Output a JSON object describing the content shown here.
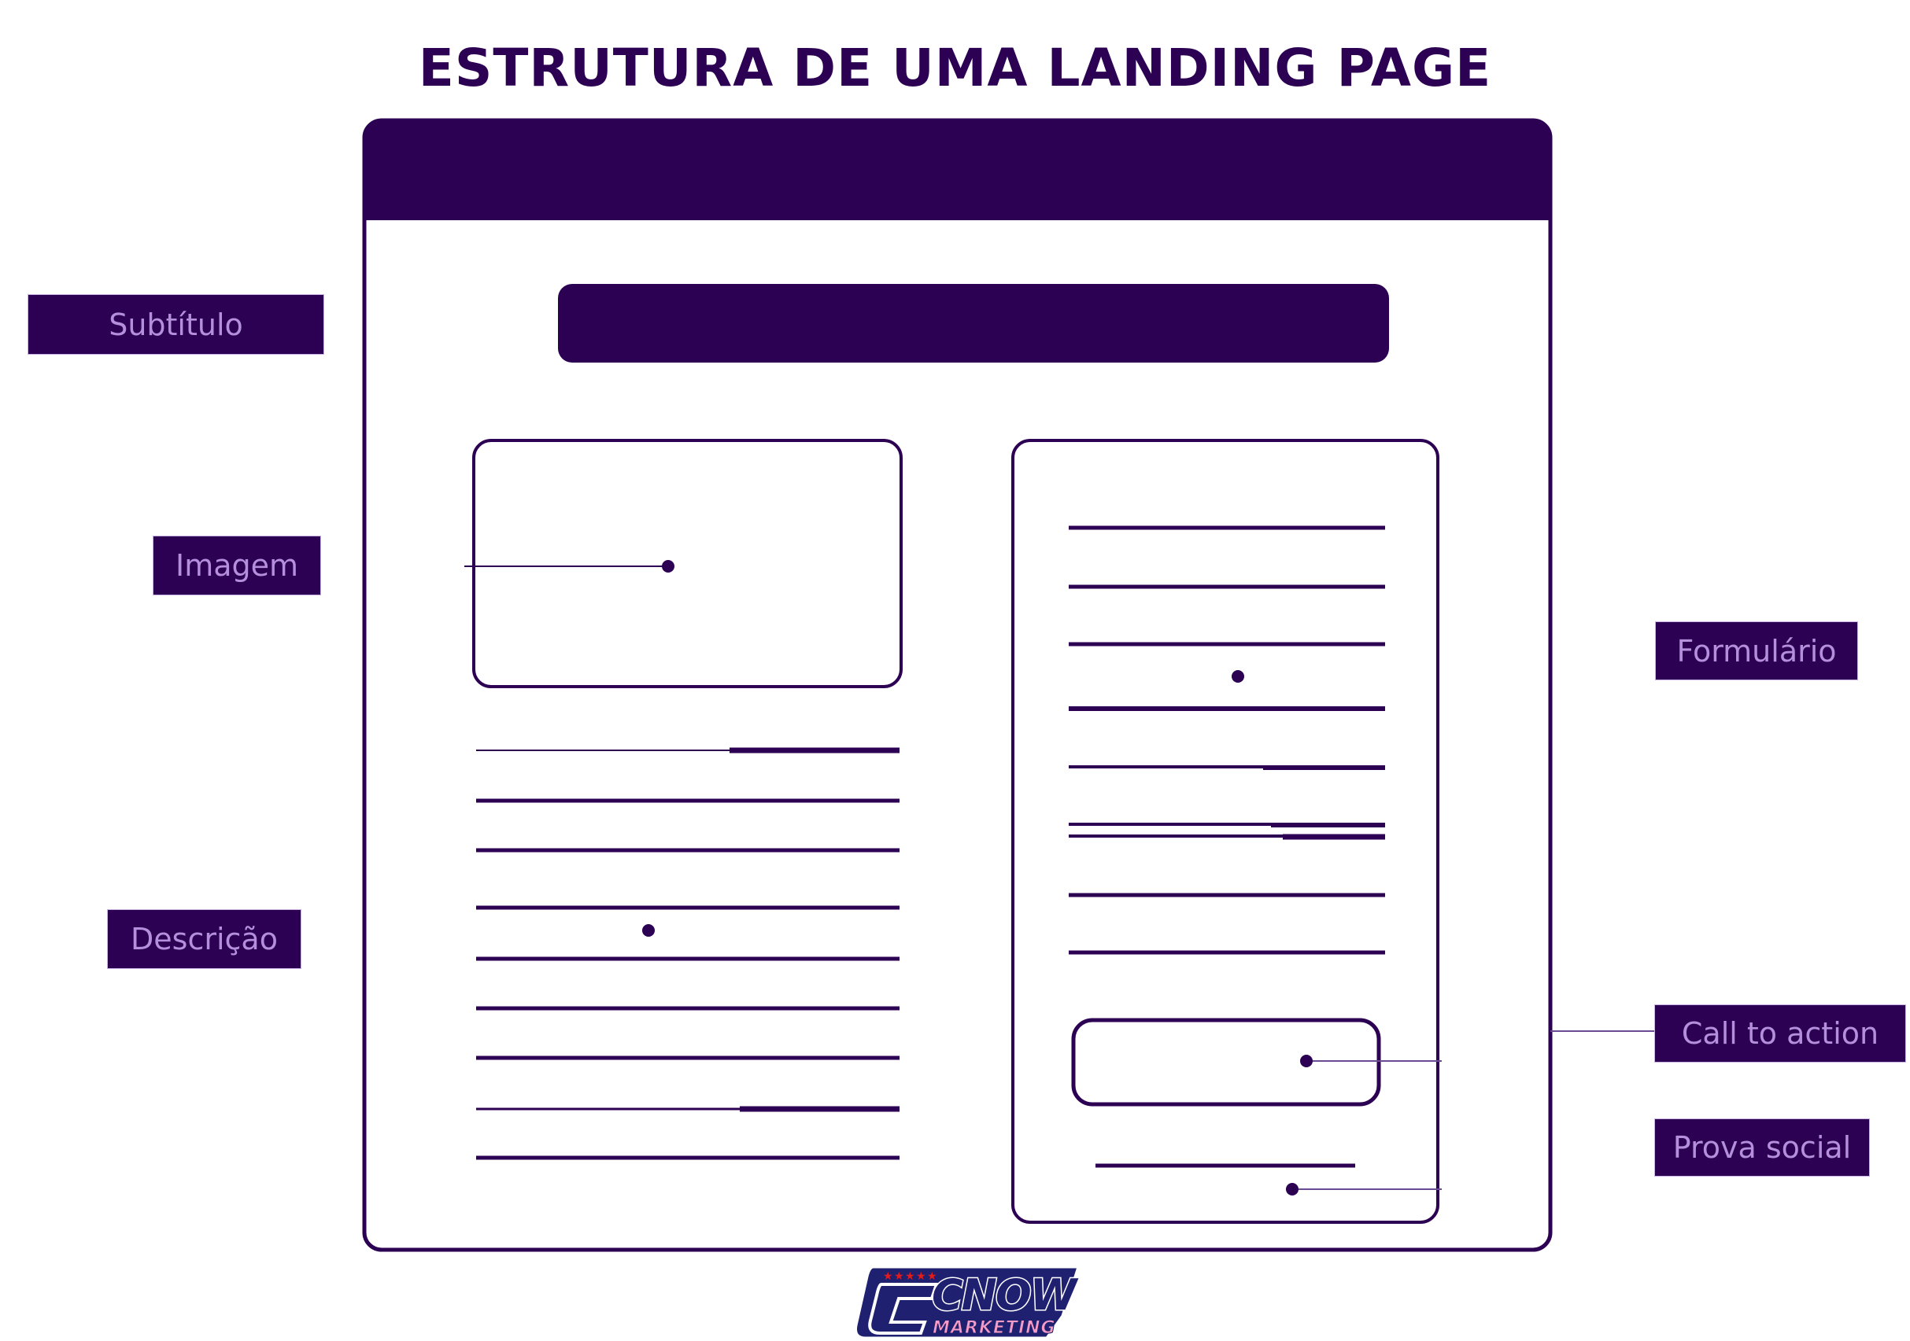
{
  "title": "ESTRUTURA DE UMA LANDING PAGE",
  "colors": {
    "primary": "#2c0052",
    "label_text": "#b48fdc",
    "background": "#ffffff",
    "logo_navy": "#1f2070",
    "logo_star": "#e41b1b",
    "logo_pink": "#f59bc5"
  },
  "labels": {
    "subtitulo": "Subtítulo",
    "imagem": "Imagem",
    "descricao": "Descrição",
    "formulario": "Formulário",
    "cta": "Call to action",
    "prova_social": "Prova social"
  },
  "wireframe": {
    "description_line_count": 9,
    "form_line_count": 9
  },
  "logo": {
    "name": "CNOW",
    "subtitle": "MARKETING",
    "star_count": 5
  }
}
